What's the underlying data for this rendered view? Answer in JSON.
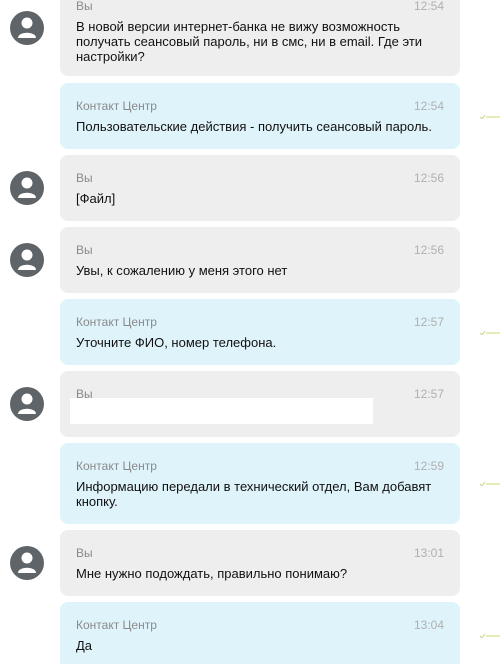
{
  "messages": [
    {
      "sender": "Вы",
      "time": "12:54",
      "text": "В новой версии интернет-банка не вижу возможность получать сеансовый пароль, ни в смс, ни в email. Где эти настройки?"
    },
    {
      "sender": "Контакт Центр",
      "time": "12:54",
      "text": "Пользовательские действия - получить сеансовый пароль."
    },
    {
      "sender": "Вы",
      "time": "12:56",
      "text": "[Файл]"
    },
    {
      "sender": "Вы",
      "time": "12:56",
      "text": "Увы, к сожалению у меня этого нет"
    },
    {
      "sender": "Контакт Центр",
      "time": "12:57",
      "text": "Уточните ФИО, номер телефона."
    },
    {
      "sender": "Вы",
      "time": "12:57",
      "text": ""
    },
    {
      "sender": "Контакт Центр",
      "time": "12:59",
      "text": "Информацию передали в технический отдел, Вам добавят кнопку."
    },
    {
      "sender": "Вы",
      "time": "13:01",
      "text": "Мне нужно подождать, правильно понимаю?"
    },
    {
      "sender": "Контакт Центр",
      "time": "13:04",
      "text": "Да"
    }
  ],
  "icons": {
    "avatar": "user-avatar-icon",
    "read_mark": "read-check-icon"
  },
  "colors": {
    "user_bubble": "#eeeeee",
    "agent_bubble": "#dff3fb",
    "avatar": "#5f6468",
    "read_mark": "#c7d88a"
  }
}
